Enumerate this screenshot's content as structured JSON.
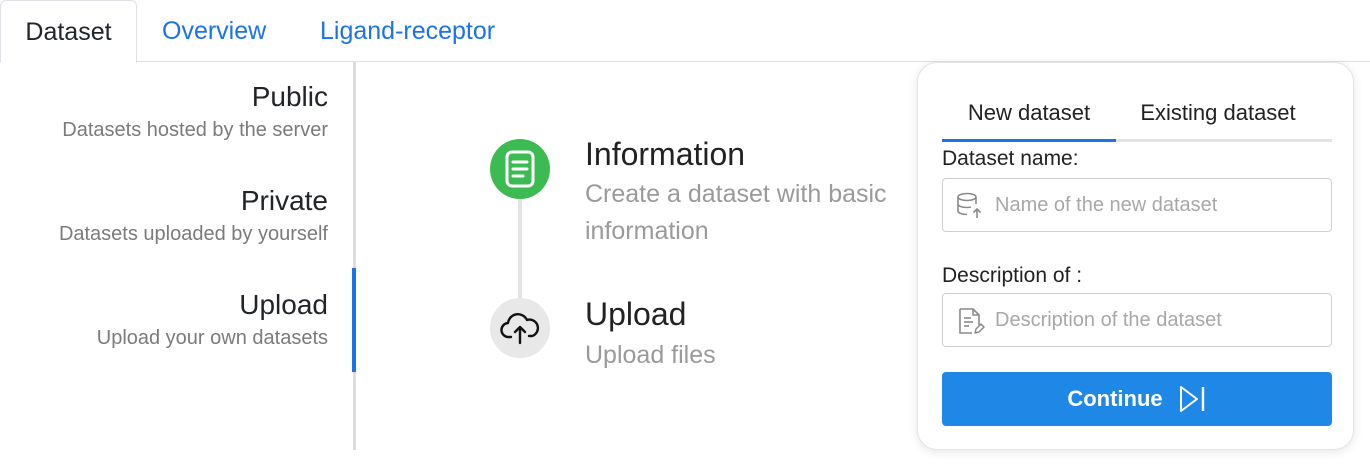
{
  "top_tabs": [
    {
      "label": "Dataset"
    },
    {
      "label": "Overview"
    },
    {
      "label": "Ligand-receptor"
    }
  ],
  "sidebar": {
    "items": [
      {
        "title": "Public",
        "subtitle": "Datasets hosted by the server"
      },
      {
        "title": "Private",
        "subtitle": "Datasets uploaded by yourself"
      },
      {
        "title": "Upload",
        "subtitle": "Upload your own datasets"
      }
    ],
    "active": "Upload"
  },
  "steps": [
    {
      "title": "Information",
      "description": "Create a dataset with basic information",
      "icon": "document-icon",
      "status": "active"
    },
    {
      "title": "Upload",
      "description": "Upload files",
      "icon": "cloud-upload-icon",
      "status": "pending"
    }
  ],
  "panel": {
    "tabs": [
      {
        "label": "New dataset"
      },
      {
        "label": "Existing dataset"
      }
    ],
    "name_label": "Dataset name:",
    "name_placeholder": "Name of the new dataset",
    "name_value": "",
    "description_label": "Description of :",
    "description_placeholder": "Description of the dataset",
    "description_value": "",
    "continue_label": "Continue"
  },
  "colors": {
    "accent": "#1a73e8",
    "button": "#1f87e5",
    "step_active": "#3dbb53",
    "step_pending": "#e8e8e8"
  }
}
